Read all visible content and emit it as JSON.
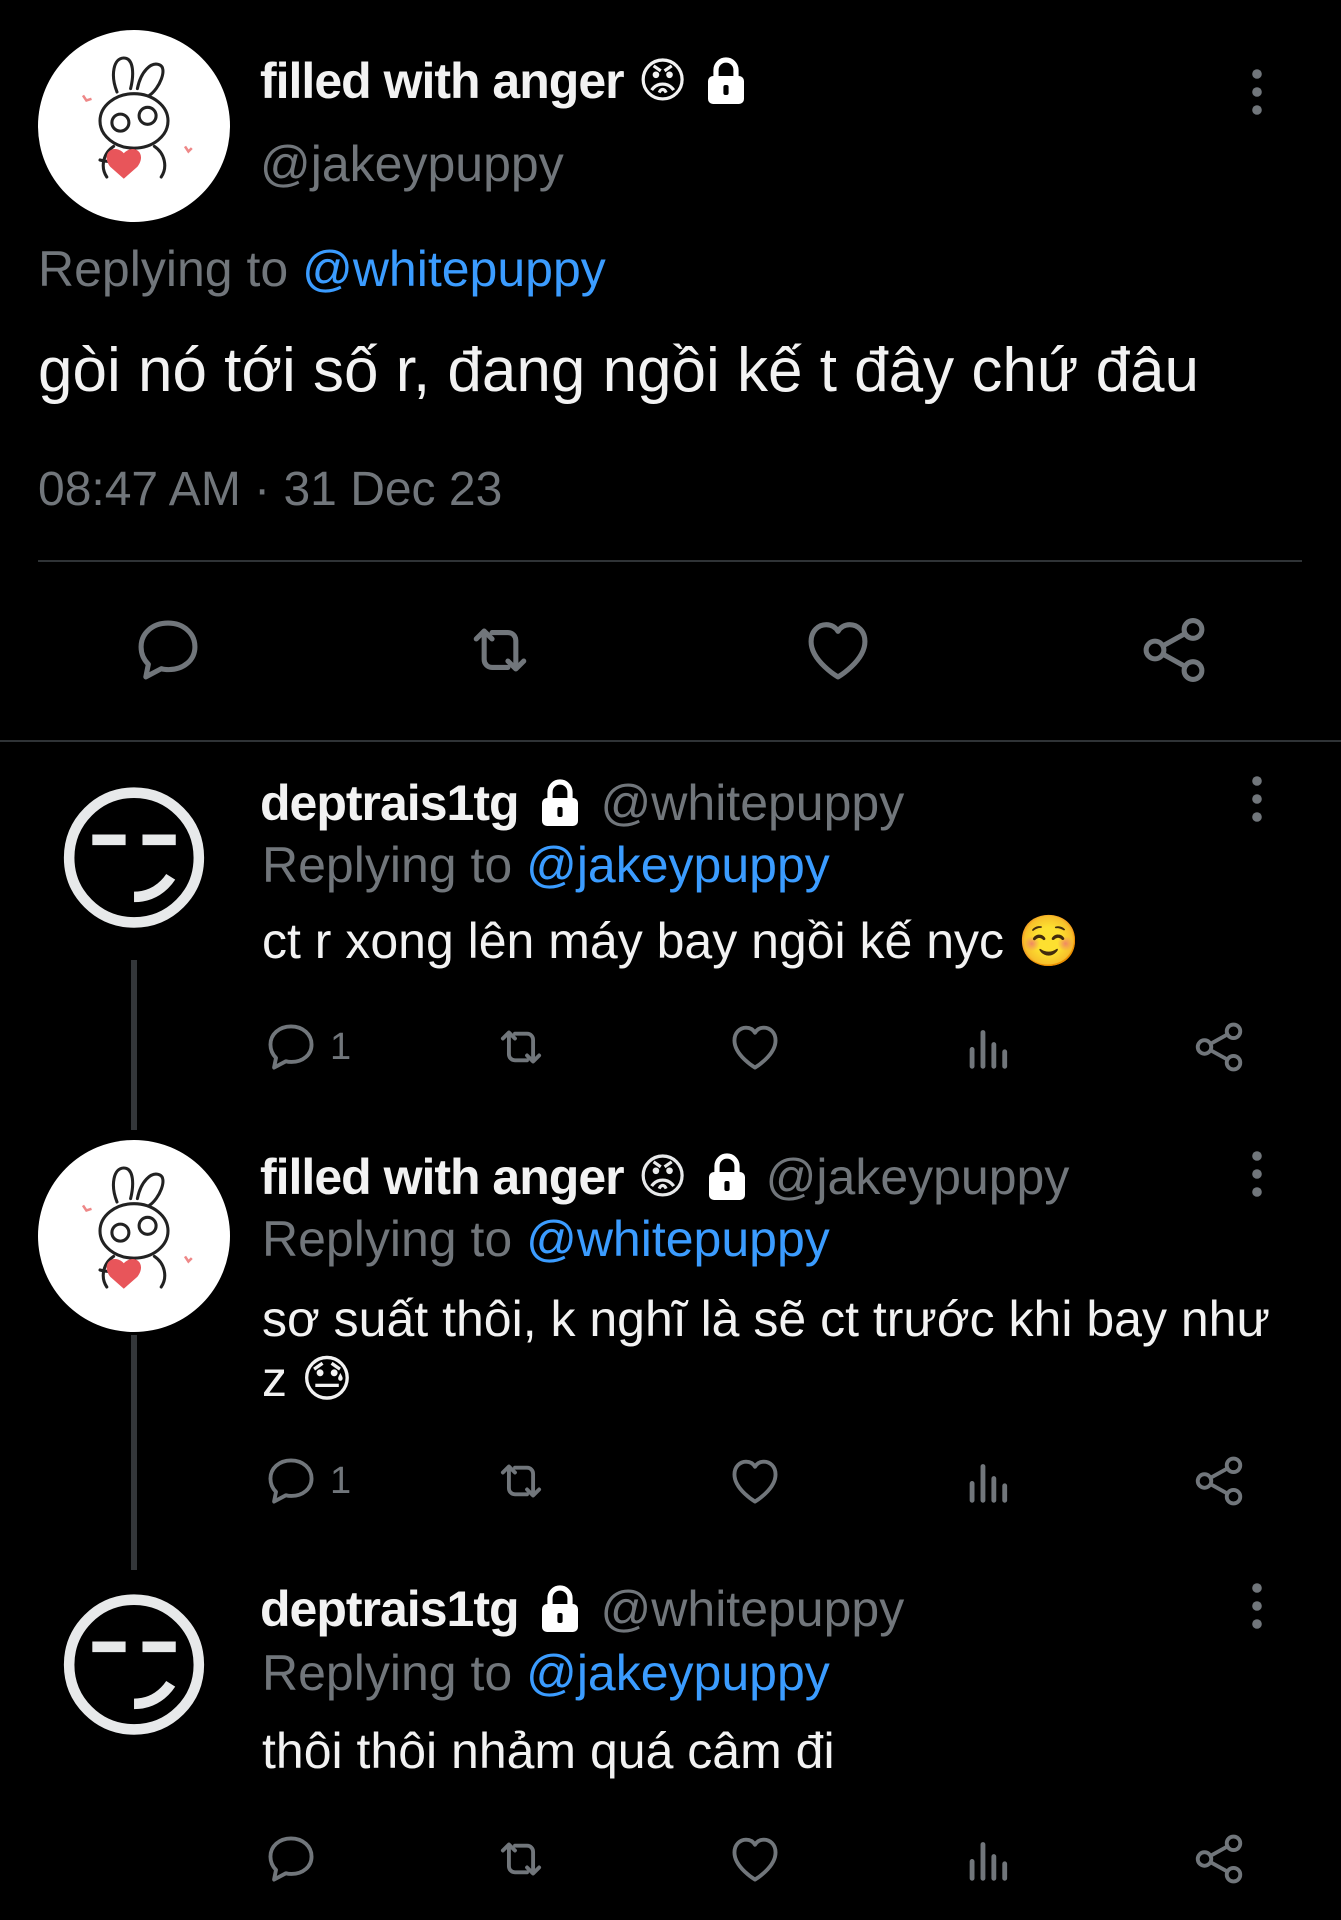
{
  "main_tweet": {
    "display_name": "filled with anger",
    "handle": "@jakeypuppy",
    "reply_prefix": "Replying to",
    "reply_to": "@whitepuppy",
    "text": "gòi nó tới số r, đang ngồi kế t đây chứ đâu",
    "timestamp": "08:47 AM · 31 Dec 23",
    "name_emoji": "😡",
    "lock": "🔒"
  },
  "replies": [
    {
      "display_name": "deptrais1tg",
      "handle": "@whitepuppy",
      "reply_prefix": "Replying to",
      "reply_to": "@jakeypuppy",
      "text": "ct r xong lên máy bay ngồi kế nyc ☺️",
      "reply_count": "1",
      "avatar_emoji": "😏"
    },
    {
      "display_name": "filled with anger",
      "handle": "@jakeypuppy",
      "reply_prefix": "Replying to",
      "reply_to": "@whitepuppy",
      "text_line1": "sơ suất thôi, k nghĩ là sẽ ct trước khi bay như",
      "text_line2": "z 😓",
      "reply_count": "1",
      "name_emoji": "😡"
    },
    {
      "display_name": "deptrais1tg",
      "handle": "@whitepuppy",
      "reply_prefix": "Replying to",
      "reply_to": "@jakeypuppy",
      "text": "thôi thôi nhảm quá câm đi",
      "avatar_emoji": "😏"
    }
  ],
  "icons": [
    "reply-icon",
    "retweet-icon",
    "like-icon",
    "share-icon",
    "analytics-icon",
    "more-icon",
    "lock-icon"
  ],
  "colors": {
    "background": "#000000",
    "accent": "#3b9cff",
    "muted": "#71767b",
    "text": "#f2f2f2"
  }
}
